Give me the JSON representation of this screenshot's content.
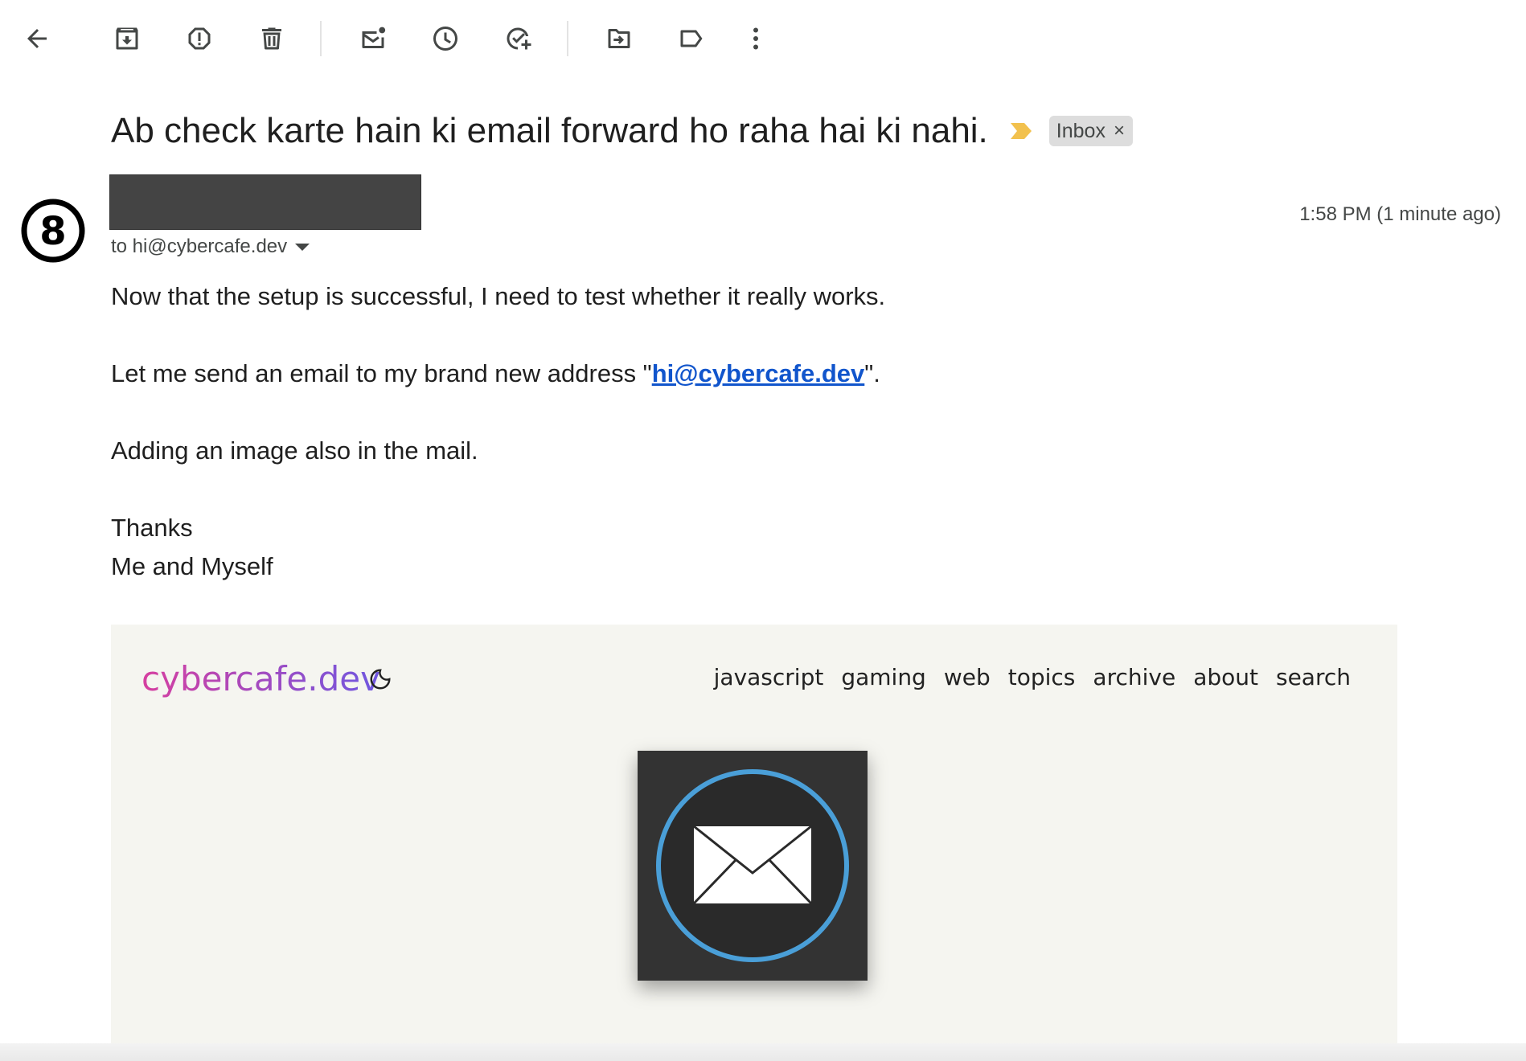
{
  "toolbar": {
    "icons": [
      "back-arrow-icon",
      "archive-icon",
      "report-spam-icon",
      "delete-icon",
      "mark-unread-icon",
      "snooze-icon",
      "add-to-tasks-icon",
      "move-to-icon",
      "label-icon",
      "more-options-icon"
    ]
  },
  "email": {
    "subject": "Ab check karte hain ki email forward ho raha hai ki nahi.",
    "label": "Inbox",
    "label_remove": "×",
    "avatar_glyph": "8",
    "recipient": "to hi@cybercafe.dev",
    "timestamp": "1:58 PM (1 minute ago)",
    "body": {
      "line1": "Now that the setup is successful, I need to test whether it really works.",
      "line2_prefix": "Let me send an email to my brand new address \"",
      "line2_link": "hi@cybercafe.dev",
      "line2_suffix": "\".",
      "line3": "Adding an image also in the mail.",
      "signoff1": "Thanks",
      "signoff2": "Me and Myself"
    }
  },
  "preview": {
    "logo": "cybercafe.dev",
    "nav": [
      "javascript",
      "gaming",
      "web",
      "topics",
      "archive",
      "about",
      "search"
    ]
  },
  "colors": {
    "link": "#1155cc",
    "importance": "#f2c14e",
    "logo_gradient_start": "#d63fa0",
    "logo_gradient_end": "#6f57e0",
    "hero_ring": "#4a9fd8"
  }
}
